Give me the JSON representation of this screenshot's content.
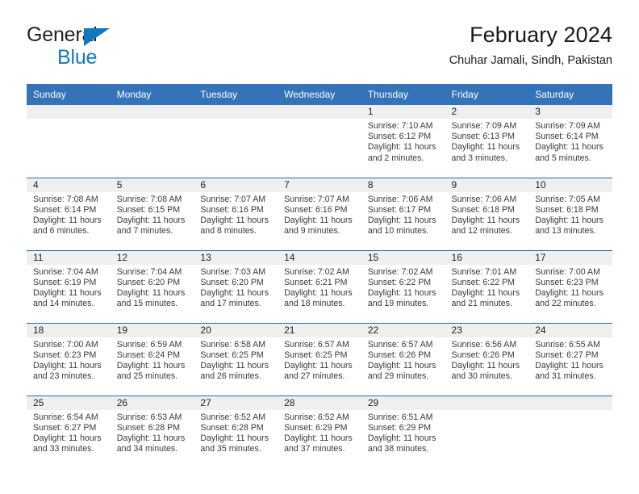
{
  "brand": {
    "line1": "General",
    "line2": "Blue",
    "triangle_icon": "triangle-icon"
  },
  "header": {
    "title": "February 2024",
    "subtitle": "Chuhar Jamali, Sindh, Pakistan"
  },
  "colors": {
    "header_blue": "#3573b9",
    "rule_blue": "#1f6cb0",
    "daynum_band": "#efefef",
    "brand_blue": "#1278be",
    "text": "#231f20"
  },
  "weekday_headers": [
    "Sunday",
    "Monday",
    "Tuesday",
    "Wednesday",
    "Thursday",
    "Friday",
    "Saturday"
  ],
  "labels": {
    "sunrise_prefix": "Sunrise:",
    "sunset_prefix": "Sunset:",
    "daylight_prefix": "Daylight:"
  },
  "weeks": [
    [
      {
        "day": "",
        "empty": true
      },
      {
        "day": "",
        "empty": true
      },
      {
        "day": "",
        "empty": true
      },
      {
        "day": "",
        "empty": true
      },
      {
        "day": "1",
        "sunrise": "Sunrise: 7:10 AM",
        "sunset": "Sunset: 6:12 PM",
        "daylight1": "Daylight: 11 hours",
        "daylight2": "and 2 minutes."
      },
      {
        "day": "2",
        "sunrise": "Sunrise: 7:09 AM",
        "sunset": "Sunset: 6:13 PM",
        "daylight1": "Daylight: 11 hours",
        "daylight2": "and 3 minutes."
      },
      {
        "day": "3",
        "sunrise": "Sunrise: 7:09 AM",
        "sunset": "Sunset: 6:14 PM",
        "daylight1": "Daylight: 11 hours",
        "daylight2": "and 5 minutes."
      }
    ],
    [
      {
        "day": "4",
        "sunrise": "Sunrise: 7:08 AM",
        "sunset": "Sunset: 6:14 PM",
        "daylight1": "Daylight: 11 hours",
        "daylight2": "and 6 minutes."
      },
      {
        "day": "5",
        "sunrise": "Sunrise: 7:08 AM",
        "sunset": "Sunset: 6:15 PM",
        "daylight1": "Daylight: 11 hours",
        "daylight2": "and 7 minutes."
      },
      {
        "day": "6",
        "sunrise": "Sunrise: 7:07 AM",
        "sunset": "Sunset: 6:16 PM",
        "daylight1": "Daylight: 11 hours",
        "daylight2": "and 8 minutes."
      },
      {
        "day": "7",
        "sunrise": "Sunrise: 7:07 AM",
        "sunset": "Sunset: 6:16 PM",
        "daylight1": "Daylight: 11 hours",
        "daylight2": "and 9 minutes."
      },
      {
        "day": "8",
        "sunrise": "Sunrise: 7:06 AM",
        "sunset": "Sunset: 6:17 PM",
        "daylight1": "Daylight: 11 hours",
        "daylight2": "and 10 minutes."
      },
      {
        "day": "9",
        "sunrise": "Sunrise: 7:06 AM",
        "sunset": "Sunset: 6:18 PM",
        "daylight1": "Daylight: 11 hours",
        "daylight2": "and 12 minutes."
      },
      {
        "day": "10",
        "sunrise": "Sunrise: 7:05 AM",
        "sunset": "Sunset: 6:18 PM",
        "daylight1": "Daylight: 11 hours",
        "daylight2": "and 13 minutes."
      }
    ],
    [
      {
        "day": "11",
        "sunrise": "Sunrise: 7:04 AM",
        "sunset": "Sunset: 6:19 PM",
        "daylight1": "Daylight: 11 hours",
        "daylight2": "and 14 minutes."
      },
      {
        "day": "12",
        "sunrise": "Sunrise: 7:04 AM",
        "sunset": "Sunset: 6:20 PM",
        "daylight1": "Daylight: 11 hours",
        "daylight2": "and 15 minutes."
      },
      {
        "day": "13",
        "sunrise": "Sunrise: 7:03 AM",
        "sunset": "Sunset: 6:20 PM",
        "daylight1": "Daylight: 11 hours",
        "daylight2": "and 17 minutes."
      },
      {
        "day": "14",
        "sunrise": "Sunrise: 7:02 AM",
        "sunset": "Sunset: 6:21 PM",
        "daylight1": "Daylight: 11 hours",
        "daylight2": "and 18 minutes."
      },
      {
        "day": "15",
        "sunrise": "Sunrise: 7:02 AM",
        "sunset": "Sunset: 6:22 PM",
        "daylight1": "Daylight: 11 hours",
        "daylight2": "and 19 minutes."
      },
      {
        "day": "16",
        "sunrise": "Sunrise: 7:01 AM",
        "sunset": "Sunset: 6:22 PM",
        "daylight1": "Daylight: 11 hours",
        "daylight2": "and 21 minutes."
      },
      {
        "day": "17",
        "sunrise": "Sunrise: 7:00 AM",
        "sunset": "Sunset: 6:23 PM",
        "daylight1": "Daylight: 11 hours",
        "daylight2": "and 22 minutes."
      }
    ],
    [
      {
        "day": "18",
        "sunrise": "Sunrise: 7:00 AM",
        "sunset": "Sunset: 6:23 PM",
        "daylight1": "Daylight: 11 hours",
        "daylight2": "and 23 minutes."
      },
      {
        "day": "19",
        "sunrise": "Sunrise: 6:59 AM",
        "sunset": "Sunset: 6:24 PM",
        "daylight1": "Daylight: 11 hours",
        "daylight2": "and 25 minutes."
      },
      {
        "day": "20",
        "sunrise": "Sunrise: 6:58 AM",
        "sunset": "Sunset: 6:25 PM",
        "daylight1": "Daylight: 11 hours",
        "daylight2": "and 26 minutes."
      },
      {
        "day": "21",
        "sunrise": "Sunrise: 6:57 AM",
        "sunset": "Sunset: 6:25 PM",
        "daylight1": "Daylight: 11 hours",
        "daylight2": "and 27 minutes."
      },
      {
        "day": "22",
        "sunrise": "Sunrise: 6:57 AM",
        "sunset": "Sunset: 6:26 PM",
        "daylight1": "Daylight: 11 hours",
        "daylight2": "and 29 minutes."
      },
      {
        "day": "23",
        "sunrise": "Sunrise: 6:56 AM",
        "sunset": "Sunset: 6:26 PM",
        "daylight1": "Daylight: 11 hours",
        "daylight2": "and 30 minutes."
      },
      {
        "day": "24",
        "sunrise": "Sunrise: 6:55 AM",
        "sunset": "Sunset: 6:27 PM",
        "daylight1": "Daylight: 11 hours",
        "daylight2": "and 31 minutes."
      }
    ],
    [
      {
        "day": "25",
        "sunrise": "Sunrise: 6:54 AM",
        "sunset": "Sunset: 6:27 PM",
        "daylight1": "Daylight: 11 hours",
        "daylight2": "and 33 minutes."
      },
      {
        "day": "26",
        "sunrise": "Sunrise: 6:53 AM",
        "sunset": "Sunset: 6:28 PM",
        "daylight1": "Daylight: 11 hours",
        "daylight2": "and 34 minutes."
      },
      {
        "day": "27",
        "sunrise": "Sunrise: 6:52 AM",
        "sunset": "Sunset: 6:28 PM",
        "daylight1": "Daylight: 11 hours",
        "daylight2": "and 35 minutes."
      },
      {
        "day": "28",
        "sunrise": "Sunrise: 6:52 AM",
        "sunset": "Sunset: 6:29 PM",
        "daylight1": "Daylight: 11 hours",
        "daylight2": "and 37 minutes."
      },
      {
        "day": "29",
        "sunrise": "Sunrise: 6:51 AM",
        "sunset": "Sunset: 6:29 PM",
        "daylight1": "Daylight: 11 hours",
        "daylight2": "and 38 minutes."
      },
      {
        "day": "",
        "empty": true
      },
      {
        "day": "",
        "empty": true
      }
    ]
  ]
}
